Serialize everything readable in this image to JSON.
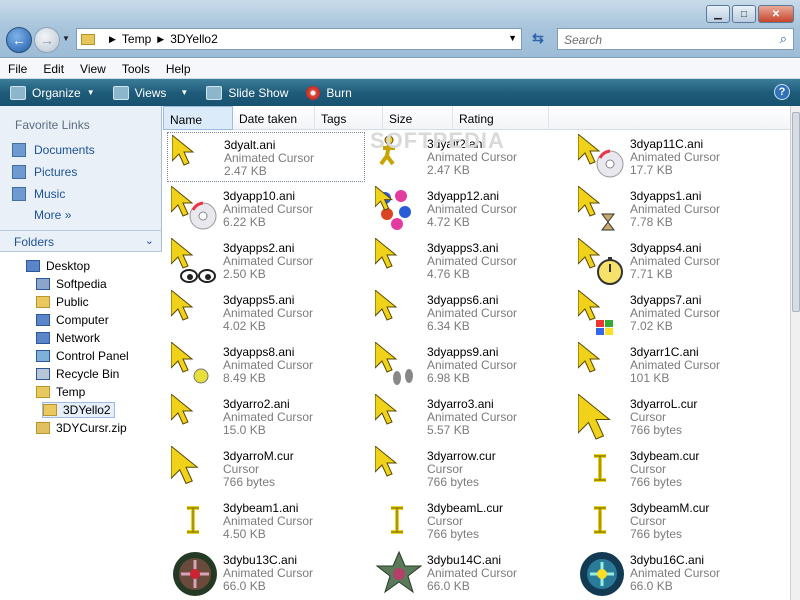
{
  "window": {
    "minimize": "▁",
    "maximize": "□",
    "close": "✕"
  },
  "address": {
    "crumbs": [
      "Temp",
      "3DYello2"
    ]
  },
  "search": {
    "placeholder": "Search"
  },
  "menu": [
    "File",
    "Edit",
    "View",
    "Tools",
    "Help"
  ],
  "toolbar": {
    "organize": "Organize",
    "views": "Views",
    "slideshow": "Slide Show",
    "burn": "Burn"
  },
  "nav": {
    "favorites_title": "Favorite Links",
    "favorites": [
      "Documents",
      "Pictures",
      "Music"
    ],
    "more": "More",
    "folders_title": "Folders",
    "tree": [
      "Desktop",
      "Softpedia",
      "Public",
      "Computer",
      "Network",
      "Control Panel",
      "Recycle Bin",
      "Temp",
      "3DYello2",
      "3DYCursr.zip"
    ]
  },
  "columns": [
    "Name",
    "Date taken",
    "Tags",
    "Size",
    "Rating"
  ],
  "files": [
    {
      "name": "3dyalt.ani",
      "type": "Animated Cursor",
      "size": "2.47 KB",
      "icon": "arrow-yellow"
    },
    {
      "name": "3dyalt2.ani",
      "type": "Animated Cursor",
      "size": "2.47 KB",
      "icon": "running-figure"
    },
    {
      "name": "3dyap11C.ani",
      "type": "Animated Cursor",
      "size": "17.7 KB",
      "icon": "arrow-cd"
    },
    {
      "name": "3dyapp10.ani",
      "type": "Animated Cursor",
      "size": "6.22 KB",
      "icon": "arrow-cd"
    },
    {
      "name": "3dyapp12.ani",
      "type": "Animated Cursor",
      "size": "4.72 KB",
      "icon": "arrow-flowers"
    },
    {
      "name": "3dyapps1.ani",
      "type": "Animated Cursor",
      "size": "7.78 KB",
      "icon": "arrow-hourglass"
    },
    {
      "name": "3dyapps2.ani",
      "type": "Animated Cursor",
      "size": "2.50 KB",
      "icon": "arrow-eyes"
    },
    {
      "name": "3dyapps3.ani",
      "type": "Animated Cursor",
      "size": "4.76 KB",
      "icon": "arrow-yellow"
    },
    {
      "name": "3dyapps4.ani",
      "type": "Animated Cursor",
      "size": "7.71 KB",
      "icon": "arrow-stopwatch"
    },
    {
      "name": "3dyapps5.ani",
      "type": "Animated Cursor",
      "size": "4.02 KB",
      "icon": "arrow-yellow"
    },
    {
      "name": "3dyapps6.ani",
      "type": "Animated Cursor",
      "size": "6.34 KB",
      "icon": "arrow-yellow"
    },
    {
      "name": "3dyapps7.ani",
      "type": "Animated Cursor",
      "size": "7.02 KB",
      "icon": "arrow-windows-flag"
    },
    {
      "name": "3dyapps8.ani",
      "type": "Animated Cursor",
      "size": "8.49 KB",
      "icon": "arrow-ball"
    },
    {
      "name": "3dyapps9.ani",
      "type": "Animated Cursor",
      "size": "6.98 KB",
      "icon": "arrow-footprints"
    },
    {
      "name": "3dyarr1C.ani",
      "type": "Animated Cursor",
      "size": "101 KB",
      "icon": "arrow-yellow"
    },
    {
      "name": "3dyarro2.ani",
      "type": "Animated Cursor",
      "size": "15.0 KB",
      "icon": "arrow-yellow"
    },
    {
      "name": "3dyarro3.ani",
      "type": "Animated Cursor",
      "size": "5.57 KB",
      "icon": "arrow-yellow"
    },
    {
      "name": "3dyarroL.cur",
      "type": "Cursor",
      "size": "766 bytes",
      "icon": "arrow-large"
    },
    {
      "name": "3dyarroM.cur",
      "type": "Cursor",
      "size": "766 bytes",
      "icon": "arrow-medium"
    },
    {
      "name": "3dyarrow.cur",
      "type": "Cursor",
      "size": "766 bytes",
      "icon": "arrow-yellow"
    },
    {
      "name": "3dybeam.cur",
      "type": "Cursor",
      "size": "766 bytes",
      "icon": "ibeam"
    },
    {
      "name": "3dybeam1.ani",
      "type": "Animated Cursor",
      "size": "4.50 KB",
      "icon": "ibeam"
    },
    {
      "name": "3dybeamL.cur",
      "type": "Cursor",
      "size": "766 bytes",
      "icon": "ibeam"
    },
    {
      "name": "3dybeamM.cur",
      "type": "Cursor",
      "size": "766 bytes",
      "icon": "ibeam"
    },
    {
      "name": "3dybu13C.ani",
      "type": "Animated Cursor",
      "size": "66.0 KB",
      "icon": "busy-orb"
    },
    {
      "name": "3dybu14C.ani",
      "type": "Animated Cursor",
      "size": "66.0 KB",
      "icon": "busy-star"
    },
    {
      "name": "3dybu16C.ani",
      "type": "Animated Cursor",
      "size": "66.0 KB",
      "icon": "busy-orb-blue"
    }
  ]
}
